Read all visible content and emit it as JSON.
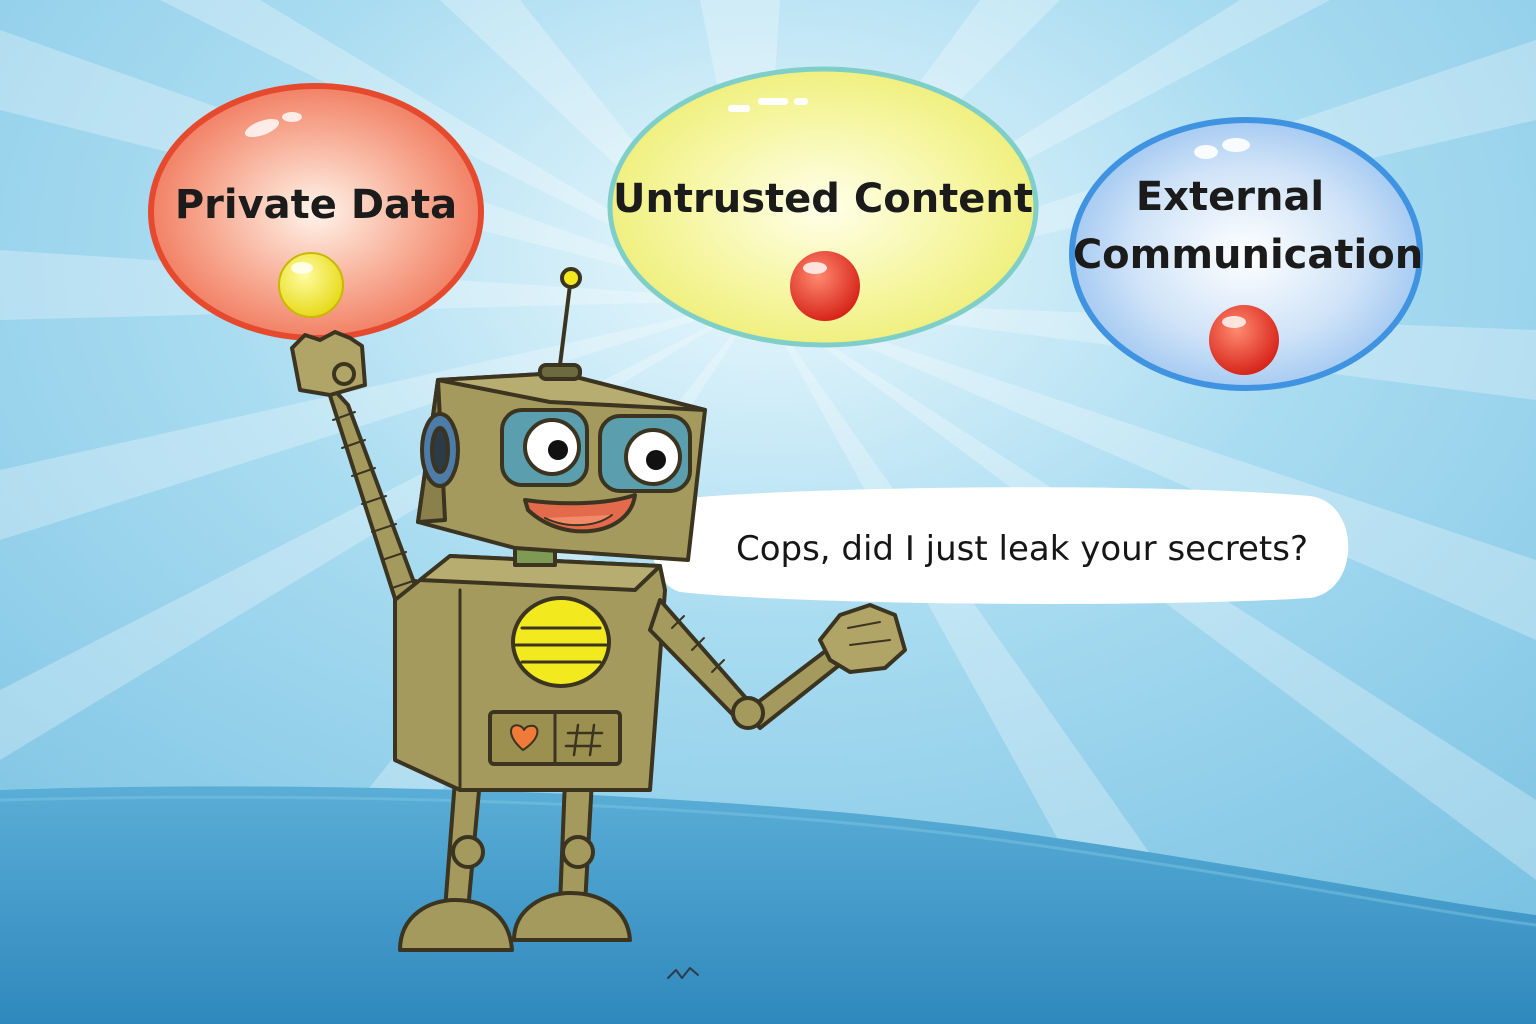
{
  "bubbles": {
    "private": {
      "label": "Private Data",
      "color": "#e64a2e",
      "dot_color": "#f2ea1e"
    },
    "untrusted": {
      "label": "Untrusted Content",
      "color": "#f0ef62",
      "dot_color": "#e22a20"
    },
    "external": {
      "label_line1": "External",
      "label_line2": "Communication",
      "color": "#4f9fe4",
      "dot_color": "#e22a20"
    }
  },
  "speech": {
    "text": "Cops, did I just leak your secrets?"
  },
  "colors": {
    "sky": "#8fcde9",
    "ground": "#3d97c8",
    "robot_body": "#a59a5e",
    "robot_outline": "#3a3420"
  }
}
